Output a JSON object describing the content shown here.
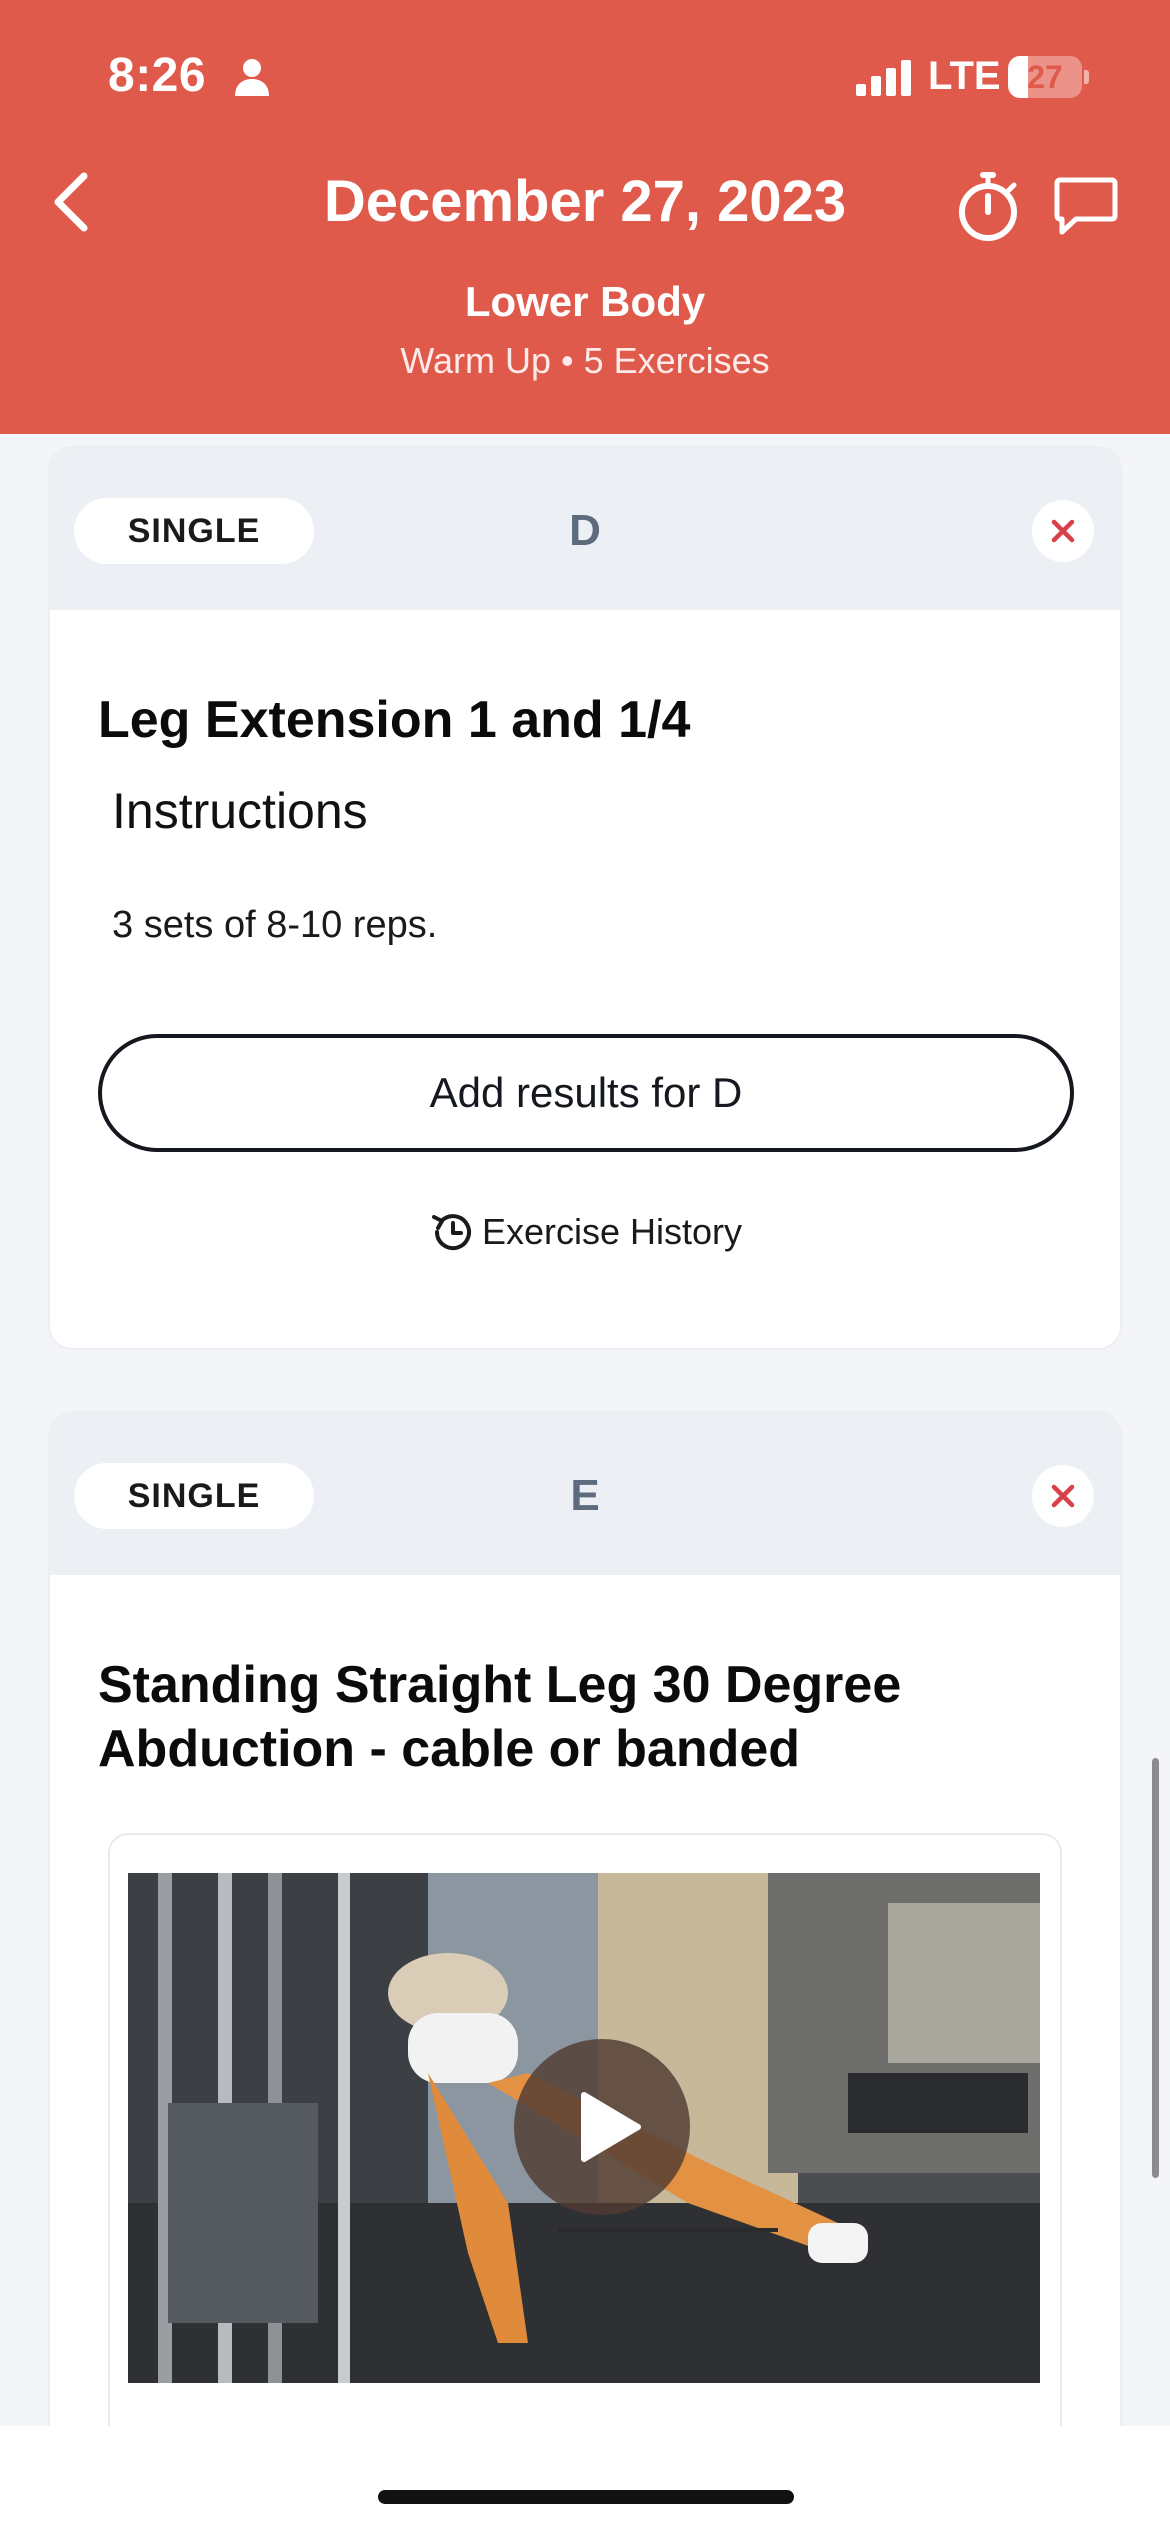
{
  "status_bar": {
    "time": "8:26",
    "network": "LTE",
    "battery_level": 27,
    "icons": [
      "person-icon",
      "signal-icon",
      "battery-icon"
    ]
  },
  "header": {
    "title": "December 27, 2023",
    "workout_name": "Lower Body",
    "workout_meta": "Warm Up • 5 Exercises",
    "icons": [
      "chevron-left-icon",
      "stopwatch-icon",
      "chat-bubble-icon"
    ],
    "background_color": "#e05a4b"
  },
  "cards": [
    {
      "type": "SINGLE",
      "letter": "D",
      "title": "Leg Extension 1 and 1/4",
      "instructions_heading": "Instructions",
      "instructions_text": "3 sets of 8-10 reps.",
      "add_results_label": "Add results for D",
      "history_label": "Exercise History"
    },
    {
      "type": "SINGLE",
      "letter": "E",
      "title_line1": "Standing Straight Leg 30 Degree",
      "title_line2": "Abduction - cable or banded"
    }
  ],
  "colors": {
    "remove_icon": "#d9404a",
    "letter": "#5d6b7e",
    "card_header": "#eceff4"
  }
}
